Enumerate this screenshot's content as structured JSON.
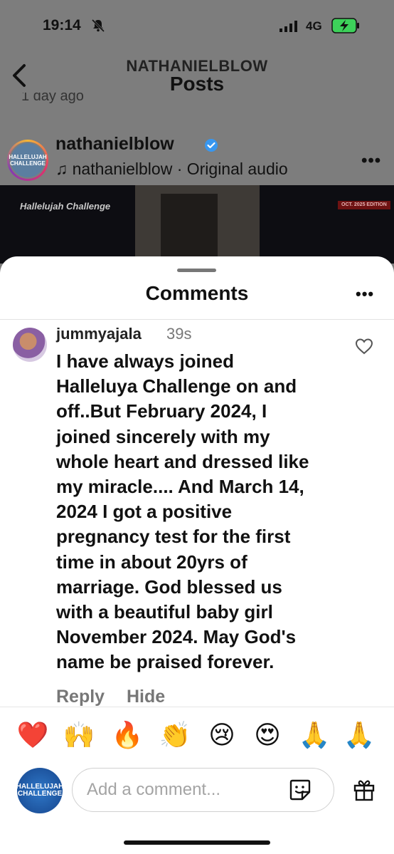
{
  "status_bar": {
    "time": "19:14",
    "network": "4G"
  },
  "header": {
    "username": "NATHANIELBLOW",
    "title": "Posts"
  },
  "time_ago": "1 day ago",
  "post": {
    "username": "nathanielblow",
    "audio": "♫ nathanielblow · Original audio",
    "avatar_text": "HALLELUJAH CHALLENGE",
    "video_logo": "Hallelujah Challenge",
    "video_badge": "OCT. 2025 EDITION"
  },
  "sheet": {
    "title": "Comments",
    "comment": {
      "username": "jummyajala",
      "time": "39s",
      "lines": [
        "I have always joined",
        "Halleluya Challenge on and",
        "off..But February 2024, I",
        "joined sincerely with my",
        "whole heart and dressed like",
        "my miracle.... And March 14,",
        "2024 I got a positive",
        "pregnancy test for the first",
        "time in about 20yrs of",
        "marriage. God blessed us",
        "with a beautiful baby girl",
        "November 2024. May God's",
        "name be praised  forever."
      ],
      "reply_label": "Reply",
      "hide_label": "Hide"
    },
    "emojis": [
      "❤️",
      "🙌",
      "🔥",
      "👏",
      "😢",
      "😍",
      "🙏",
      "🙏"
    ],
    "input": {
      "placeholder": "Add a comment...",
      "value": ""
    },
    "me_avatar_text": "HALLELUJAH CHALLENGE"
  },
  "colors": {
    "sheet_bg": "#ffffff",
    "overlay": "#7d7d7d",
    "muted_text": "#777777",
    "verified": "#3897f0"
  }
}
